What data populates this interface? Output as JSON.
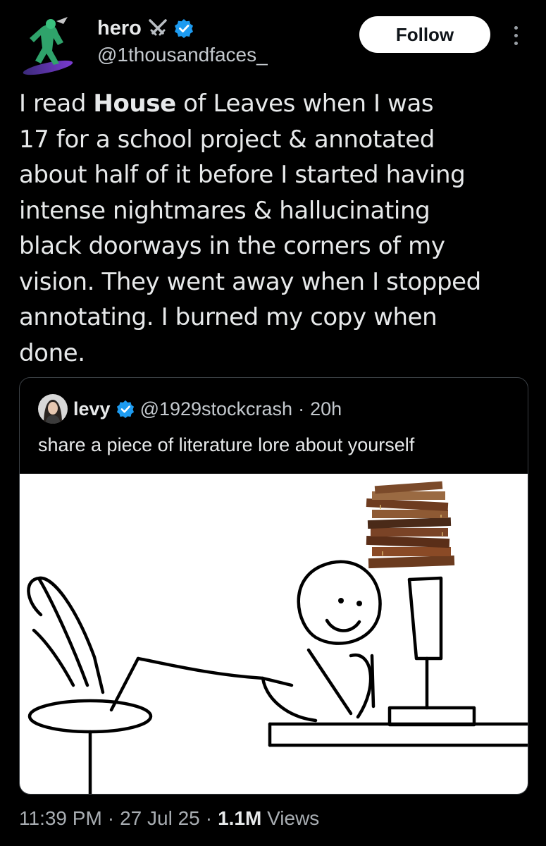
{
  "author": {
    "name": "hero",
    "handle": "@1thousandfaces_",
    "verified": true,
    "name_badge_icon": "crossed-swords-icon",
    "avatar_icon": "surfer-figure-icon"
  },
  "follow_label": "Follow",
  "more_icon": "more-vertical-icon",
  "tweet": {
    "line1_pre": "I read ",
    "line1_bold": "House",
    "line1_post": " of Leaves when I was",
    "lines": [
      "17 for a school project & annotated",
      "about half of it before I started having",
      "intense nightmares & hallucinating",
      "black doorways in the corners of my",
      "vision. They went away when I stopped",
      "annotating. I burned my copy when",
      "done."
    ]
  },
  "quote": {
    "name": "levy",
    "handle": "@1929stockcrash",
    "time": "20h",
    "separator": "·",
    "verified": true,
    "text": "share a piece of literature lore about yourself",
    "image_icon": "stick-figure-reading-meme-image"
  },
  "footer": {
    "time": "11:39 PM",
    "date": "27 Jul 25",
    "separator": "·",
    "views_count": "1.1M",
    "views_label": "Views"
  },
  "colors": {
    "background": "#000000",
    "text_primary": "#e7e9ea",
    "text_secondary": "#c4c9ce",
    "verified_blue": "#1d9bf0",
    "follow_bg": "#ffffff"
  }
}
